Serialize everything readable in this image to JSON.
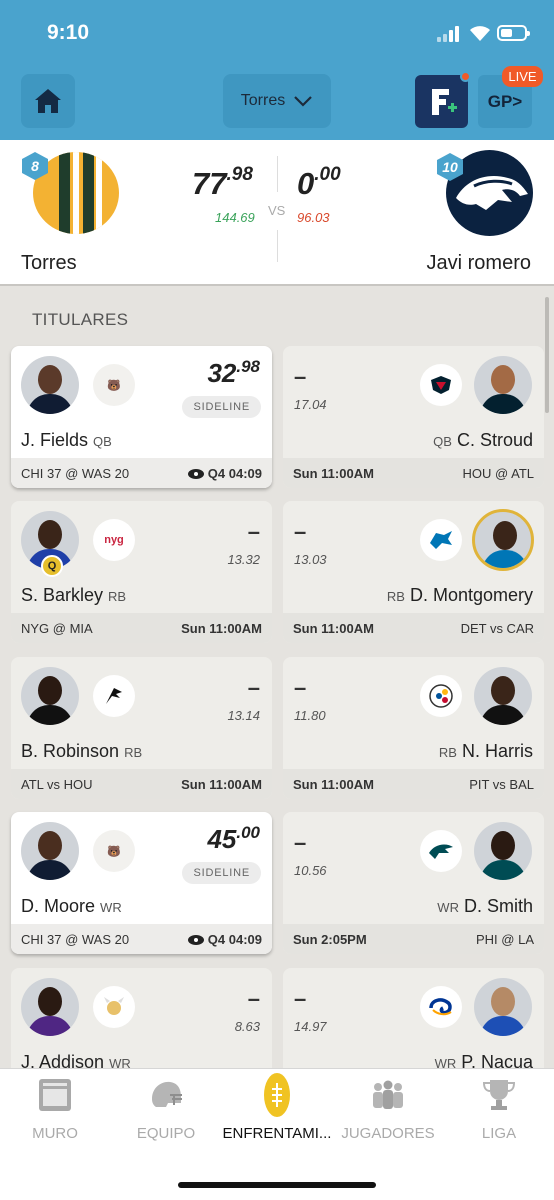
{
  "status_bar": {
    "time": "9:10"
  },
  "header": {
    "home_icon": "home-icon",
    "dropdown_label": "Torres",
    "fantasy_button_letter": "F",
    "gp_label": "GP>",
    "live_badge": "LIVE"
  },
  "matchup": {
    "left": {
      "name": "Torres",
      "rank": "8",
      "score_int": "77",
      "score_dec": ".98",
      "projection": "144.69"
    },
    "right": {
      "name": "Javi romero",
      "rank": "10",
      "score_int": "0",
      "score_dec": ".00",
      "projection": "96.03"
    },
    "vs": "VS"
  },
  "section_title": "TITULARES",
  "left_cards": [
    {
      "name": "J. Fields",
      "pos": "QB",
      "score_int": "32",
      "score_dec": ".98",
      "chip": "SIDELINE",
      "projection": "",
      "foot_left": "CHI 37 @ WAS 20",
      "foot_right": "Q4 04:09",
      "team_abbr": "CHI",
      "live": true
    },
    {
      "name": "S. Barkley",
      "pos": "RB",
      "dash": "–",
      "projection": "13.32",
      "foot_left": "NYG @ MIA",
      "foot_right": "Sun 11:00AM",
      "team_abbr": "nyg",
      "badge": "Q"
    },
    {
      "name": "B. Robinson",
      "pos": "RB",
      "dash": "–",
      "projection": "13.14",
      "foot_left": "ATL vs HOU",
      "foot_right": "Sun 11:00AM",
      "team_abbr": "ATL"
    },
    {
      "name": "D. Moore",
      "pos": "WR",
      "score_int": "45",
      "score_dec": ".00",
      "chip": "SIDELINE",
      "foot_left": "CHI 37 @ WAS 20",
      "foot_right": "Q4 04:09",
      "team_abbr": "CHI",
      "live": true
    },
    {
      "name": "J. Addison",
      "pos": "WR",
      "dash": "–",
      "projection": "8.63",
      "team_abbr": "MIN"
    }
  ],
  "right_cards": [
    {
      "name": "C. Stroud",
      "pos": "QB",
      "dash": "–",
      "projection": "17.04",
      "foot_left": "Sun 11:00AM",
      "foot_right": "HOU @ ATL",
      "team_abbr": "HOU"
    },
    {
      "name": "D. Montgomery",
      "pos": "RB",
      "dash": "–",
      "projection": "13.03",
      "foot_left": "Sun 11:00AM",
      "foot_right": "DET vs CAR",
      "team_abbr": "DET"
    },
    {
      "name": "N. Harris",
      "pos": "RB",
      "dash": "–",
      "projection": "11.80",
      "foot_left": "Sun 11:00AM",
      "foot_right": "PIT vs BAL",
      "team_abbr": "PIT"
    },
    {
      "name": "D. Smith",
      "pos": "WR",
      "dash": "–",
      "projection": "10.56",
      "foot_left": "Sun 2:05PM",
      "foot_right": "PHI @ LA",
      "team_abbr": "PHI"
    },
    {
      "name": "P. Nacua",
      "pos": "WR",
      "dash": "–",
      "projection": "14.97",
      "team_abbr": "LAR"
    }
  ],
  "tabs": [
    {
      "label": "MURO",
      "icon": "feed-icon"
    },
    {
      "label": "EQUIPO",
      "icon": "helmet-icon"
    },
    {
      "label": "ENFRENTAMI...",
      "icon": "football-icon",
      "active": true
    },
    {
      "label": "JUGADORES",
      "icon": "players-icon"
    },
    {
      "label": "LIGA",
      "icon": "trophy-icon"
    }
  ],
  "colors": {
    "header_blue": "#4aa3cd",
    "accent_orange": "#f05a28",
    "projection_green": "#3aa35a",
    "projection_red": "#d9482b",
    "navy": "#1a3462"
  }
}
